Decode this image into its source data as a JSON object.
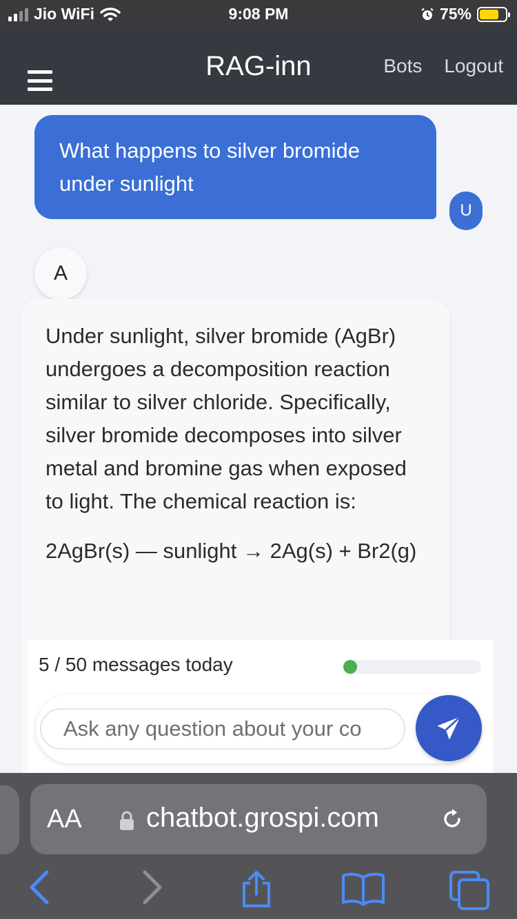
{
  "status_bar": {
    "carrier": "Jio WiFi",
    "time": "9:08 PM",
    "battery_percent": "75%",
    "battery_level": 0.75
  },
  "navbar": {
    "brand": "RAG-inn",
    "links": [
      "Bots",
      "Logout"
    ]
  },
  "chat": {
    "user_message": "What happens to silver bromide under sunlight",
    "user_avatar": "U",
    "bot_avatar": "A",
    "bot_paragraphs": [
      "Under sunlight, silver bromide (AgBr) undergoes a decomposition reaction similar to silver chloride. Specifically, silver bromide decomposes into silver metal and bromine gas when exposed to light. The chemical reaction is:",
      "2AgBr(s) — sunlight → 2Ag(s) + Br2(g)"
    ]
  },
  "usage": {
    "text": "5 / 50 messages today",
    "used": 5,
    "limit": 50
  },
  "composer": {
    "placeholder": "Ask any question about your co"
  },
  "browser": {
    "aa_label": "AA",
    "url": "chatbot.grospi.com"
  },
  "colors": {
    "accent": "#3b6fd6",
    "navbar": "#343a40",
    "progress": "#4cae4f",
    "send": "#3559c7",
    "ios_blue": "#4a8cf7"
  }
}
